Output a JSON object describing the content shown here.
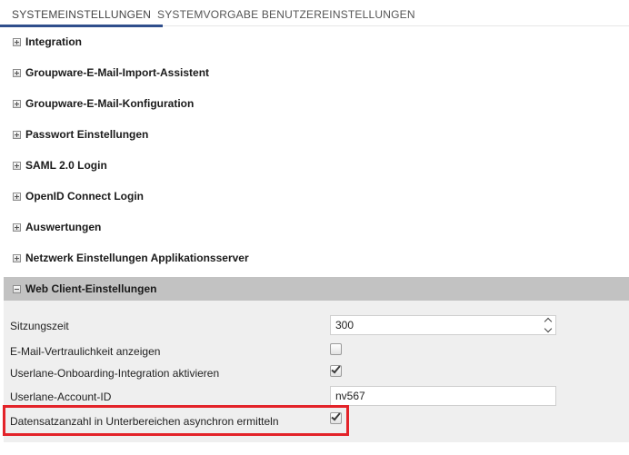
{
  "tabs": [
    {
      "label": "SYSTEMEINSTELLUNGEN",
      "active": true
    },
    {
      "label": "SYSTEMVORGABE BENUTZEREINSTELLUNGEN",
      "active": false
    }
  ],
  "sections": [
    {
      "title": "Integration",
      "expanded": false
    },
    {
      "title": "Groupware-E-Mail-Import-Assistent",
      "expanded": false
    },
    {
      "title": "Groupware-E-Mail-Konfiguration",
      "expanded": false
    },
    {
      "title": "Passwort Einstellungen",
      "expanded": false
    },
    {
      "title": "SAML 2.0 Login",
      "expanded": false
    },
    {
      "title": "OpenID Connect Login",
      "expanded": false
    },
    {
      "title": "Auswertungen",
      "expanded": false
    },
    {
      "title": "Netzwerk Einstellungen Applikationsserver",
      "expanded": false
    }
  ],
  "web_client": {
    "title": "Web Client-Einstellungen",
    "expanded": true,
    "fields": {
      "sitzungszeit": {
        "label": "Sitzungszeit",
        "value": "300"
      },
      "email_vertraulichkeit": {
        "label": "E-Mail-Vertraulichkeit anzeigen",
        "checked": false
      },
      "userlane_onboarding": {
        "label": "Userlane-Onboarding-Integration aktivieren",
        "checked": true
      },
      "userlane_account": {
        "label": "Userlane-Account-ID",
        "value": "nv567"
      },
      "datensatzanzahl": {
        "label": "Datensatzanzahl in Unterbereichen asynchron ermitteln",
        "checked": true
      }
    }
  },
  "icons": {
    "collapsed": "expand-plus-icon",
    "expanded": "collapse-minus-icon",
    "check": "checkmark-icon"
  },
  "colors": {
    "tab_underline": "#2f4e8c",
    "open_section_header": "#c2c2c2",
    "panel_background": "#efefef",
    "highlight_border": "#e32329"
  }
}
